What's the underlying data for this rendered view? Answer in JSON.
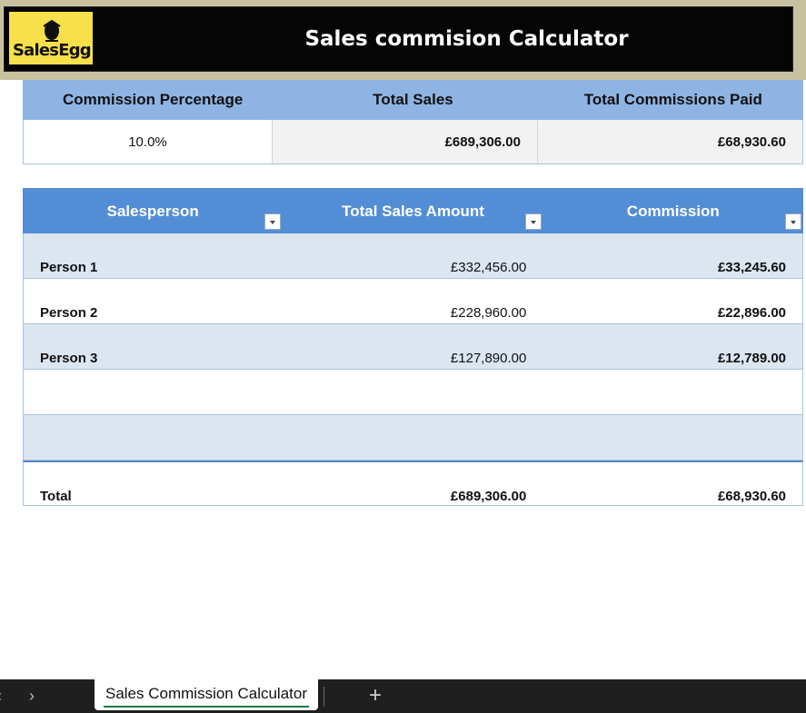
{
  "header": {
    "logo_text": "SalesEgg",
    "title": "Sales commision Calculator"
  },
  "summary": {
    "headers": [
      "Commission Percentage",
      "Total Sales",
      "Total Commissions Paid"
    ],
    "commission_percentage": "10.0%",
    "total_sales": "£689,306.00",
    "total_commissions_paid": "£68,930.60"
  },
  "table": {
    "headers": [
      "Salesperson",
      "Total Sales Amount",
      "Commission"
    ],
    "rows": [
      {
        "name": "Person 1",
        "amount": "£332,456.00",
        "commission": "£33,245.60"
      },
      {
        "name": "Person 2",
        "amount": "£228,960.00",
        "commission": "£22,896.00"
      },
      {
        "name": "Person 3",
        "amount": "£127,890.00",
        "commission": "£12,789.00"
      },
      {
        "name": "",
        "amount": "",
        "commission": ""
      },
      {
        "name": "",
        "amount": "",
        "commission": ""
      }
    ],
    "total": {
      "label": "Total",
      "amount": "£689,306.00",
      "commission": "£68,930.60"
    }
  },
  "tabs": {
    "sheet_name": "Sales Commission Calculator",
    "prev_icon": "‹",
    "next_icon": "›",
    "add_icon": "+"
  },
  "colors": {
    "summary_header": "#8eb4e3",
    "table_header": "#538dd5",
    "band_row": "#dce6f1",
    "logo_bg": "#f7e04a"
  }
}
